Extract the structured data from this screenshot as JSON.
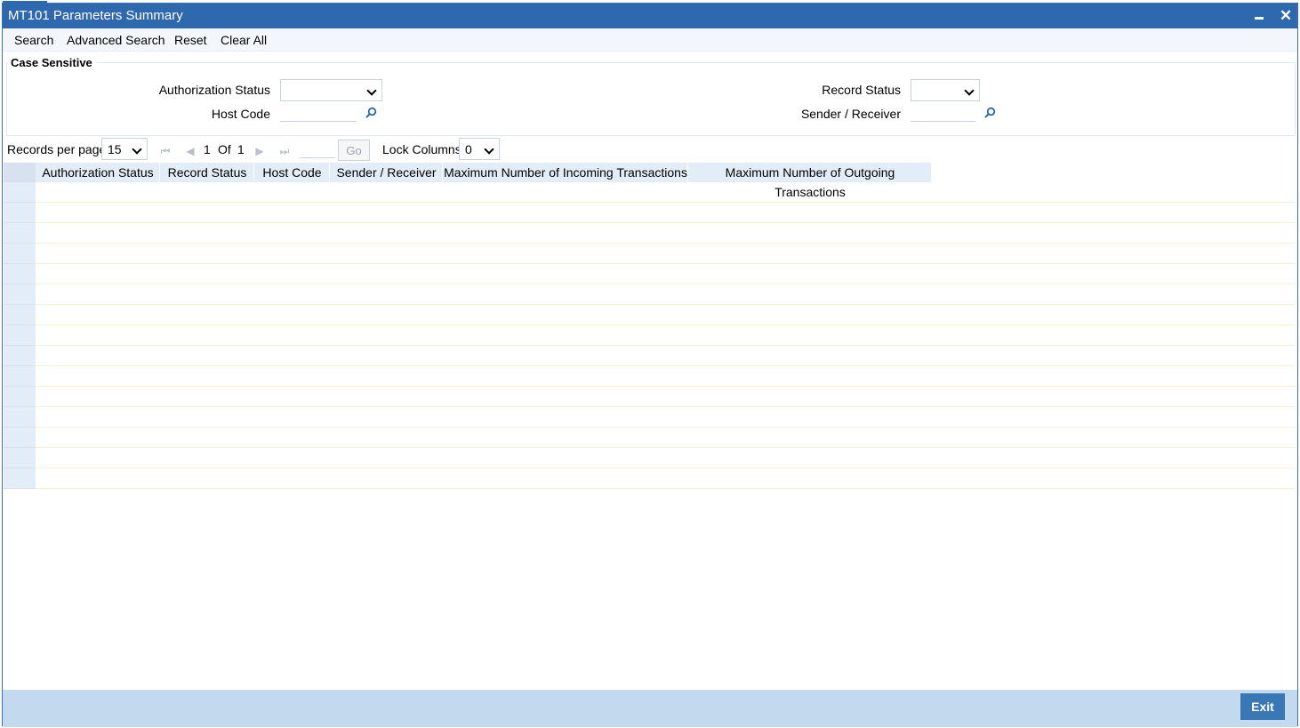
{
  "window": {
    "title": "MT101 Parameters Summary"
  },
  "toolbar": {
    "search": "Search",
    "advanced_search": "Advanced Search",
    "reset": "Reset",
    "clear_all": "Clear All"
  },
  "criteria": {
    "legend": "Case Sensitive",
    "authorization_status_label": "Authorization Status",
    "authorization_status_value": "",
    "record_status_label": "Record Status",
    "record_status_value": "",
    "host_code_label": "Host Code",
    "host_code_value": "",
    "sender_receiver_label": "Sender / Receiver",
    "sender_receiver_value": ""
  },
  "pager": {
    "records_per_page_label": "Records per page",
    "records_per_page_value": "15",
    "current_page": "1",
    "of_label": "Of",
    "total_pages": "1",
    "go_label": "Go",
    "page_input": "",
    "lock_columns_label": "Lock Columns",
    "lock_columns_value": "0"
  },
  "grid": {
    "columns": [
      "Authorization Status",
      "Record Status",
      "Host Code",
      "Sender / Receiver",
      "Maximum Number of Incoming Transactions",
      "Maximum Number of Outgoing Transactions"
    ],
    "row_count": 15
  },
  "footer": {
    "exit_label": "Exit"
  },
  "icons": {
    "minimize": "minimize-icon",
    "close": "close-icon",
    "lookup": "magnifier-icon",
    "dropdown": "chevron-down-icon",
    "first": "first-page-icon",
    "prev": "prev-page-icon",
    "next": "next-page-icon",
    "last": "last-page-icon"
  },
  "colors": {
    "titlebar": "#2e68ae",
    "footer": "#c2d9ee",
    "exit_button": "#3a78b5",
    "grid_header": "#e3edf8"
  }
}
